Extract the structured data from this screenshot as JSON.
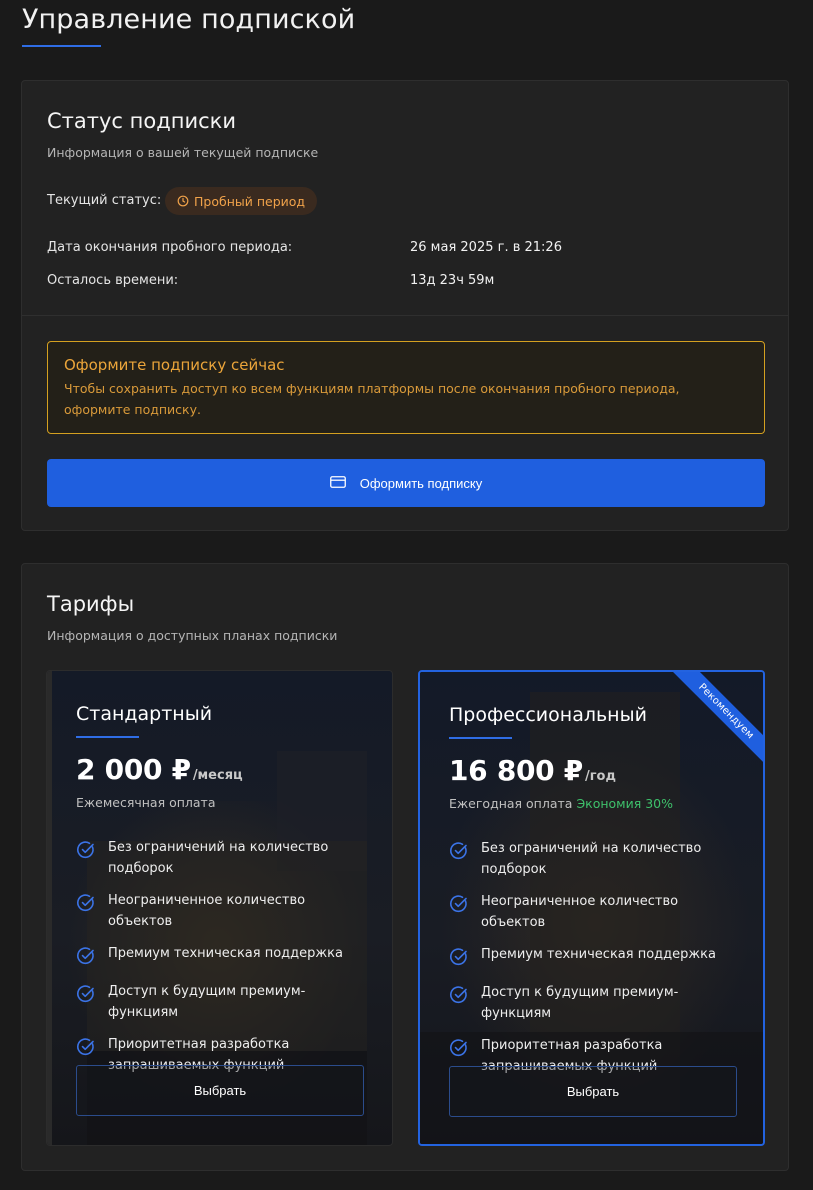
{
  "page": {
    "title": "Управление подпиской"
  },
  "status": {
    "title": "Статус подписки",
    "subtitle": "Информация о вашей текущей подписке",
    "current_label": "Текущий статус:",
    "badge_label": "Пробный период",
    "badge_icon": "clock-icon",
    "trial_end_label": "Дата окончания пробного периода:",
    "trial_end_value": "26 мая 2025 г. в 21:26",
    "remaining_label": "Осталось времени:",
    "remaining_value": "13д 23ч 59м",
    "alert_title": "Оформите подписку сейчас",
    "alert_text": "Чтобы сохранить доступ ко всем функциям платформы после окончания пробного периода, оформите подписку.",
    "subscribe_label": "Оформить подписку",
    "subscribe_icon": "credit-card-icon"
  },
  "plans": {
    "title": "Тарифы",
    "subtitle": "Информация о доступных планах подписки",
    "items": [
      {
        "name": "Стандартный",
        "price": "2 000 ₽",
        "period": "/месяц",
        "note": "Ежемесячная оплата",
        "savings": "",
        "features": [
          "Без ограничений на количество подборок",
          "Неограниченное количество объектов",
          "Премиум техническая поддержка",
          "Доступ к будущим премиум-функциям",
          "Приоритетная разработка запрашиваемых функций"
        ],
        "button": "Выбрать"
      },
      {
        "name": "Профессиональный",
        "price": "16 800 ₽",
        "period": "/год",
        "note": "Ежегодная оплата",
        "savings": "Экономия 30%",
        "ribbon": "Рекомендуем",
        "features": [
          "Без ограничений на количество подборок",
          "Неограниченное количество объектов",
          "Премиум техническая поддержка",
          "Доступ к будущим премиум-функциям",
          "Приоритетная разработка запрашиваемых функций"
        ],
        "button": "Выбрать"
      }
    ]
  },
  "colors": {
    "accent": "#1f5fdf",
    "warning": "#eba53a",
    "success": "#3ec06b",
    "background": "#1a1a1a",
    "card": "#222222"
  }
}
